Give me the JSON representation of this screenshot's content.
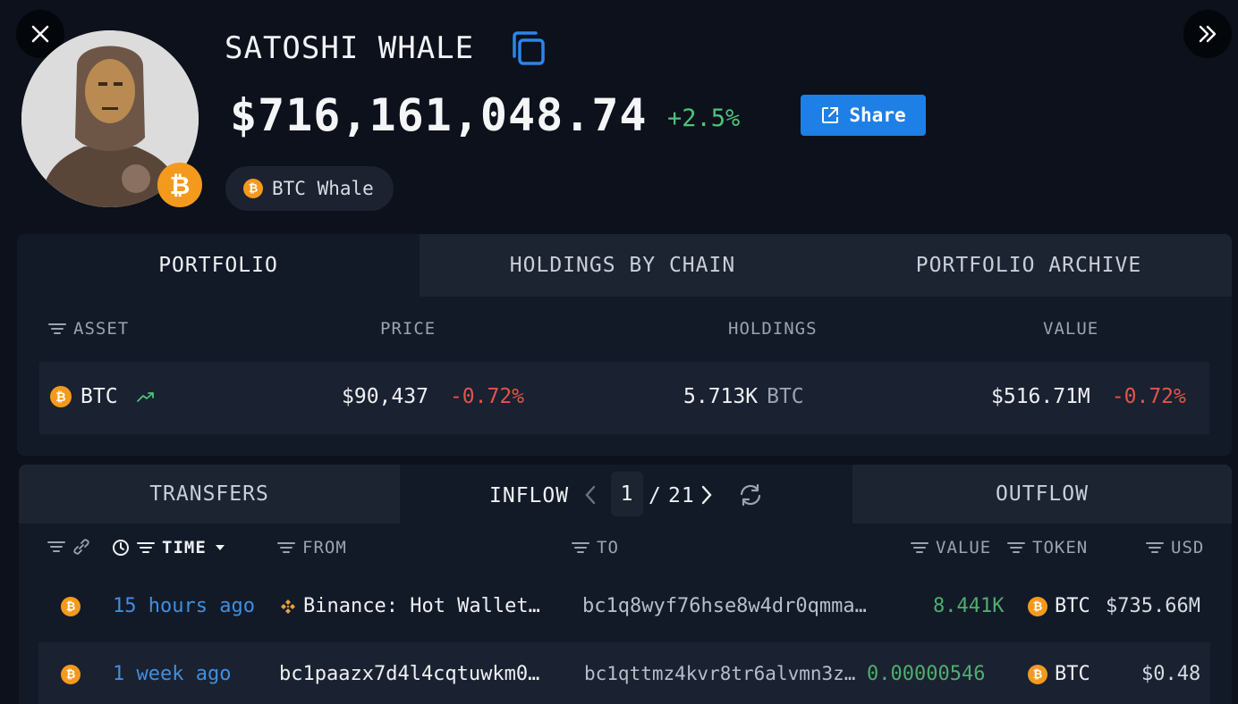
{
  "header": {
    "name": "SATOSHI WHALE",
    "balance": "$716,161,048.74",
    "change": "+2.5%",
    "share_label": "Share",
    "tag_label": "BTC Whale",
    "coin_symbol": "₿"
  },
  "portfolio_tabs": [
    "PORTFOLIO",
    "HOLDINGS BY CHAIN",
    "PORTFOLIO ARCHIVE"
  ],
  "portfolio_columns": {
    "asset": "ASSET",
    "price": "PRICE",
    "holdings": "HOLDINGS",
    "value": "VALUE"
  },
  "portfolio_rows": [
    {
      "asset": "BTC",
      "price": "$90,437",
      "price_change": "-0.72%",
      "holdings": "5.713K",
      "holdings_unit": "BTC",
      "value": "$516.71M",
      "value_change": "-0.72%"
    }
  ],
  "transfer_tabs": {
    "transfers": "TRANSFERS",
    "inflow": "INFLOW",
    "outflow": "OUTFLOW"
  },
  "pagination": {
    "current": "1",
    "separator": "/",
    "total": "21"
  },
  "transfer_columns": {
    "time": "TIME",
    "from": "FROM",
    "to": "TO",
    "value": "VALUE",
    "token": "TOKEN",
    "usd": "USD"
  },
  "transfer_rows": [
    {
      "time": "15 hours ago",
      "from": "Binance: Hot Wallet…",
      "to": "bc1q8wyf76hse8w4dr0qmma…",
      "value": "8.441K",
      "token": "BTC",
      "usd": "$735.66M"
    },
    {
      "time": "1 week ago",
      "from": "bc1paazx7d4l4cqtuwkm0…",
      "to": "bc1qttmz4kvr8tr6alvmn3z…",
      "value": "0.00000546",
      "token": "BTC",
      "usd": "$0.48"
    }
  ],
  "colors": {
    "accent": "#1e7fe6",
    "positive": "#4fc27a",
    "negative": "#e5534b",
    "btc": "#f39a1d",
    "link": "#3f8fe0"
  }
}
